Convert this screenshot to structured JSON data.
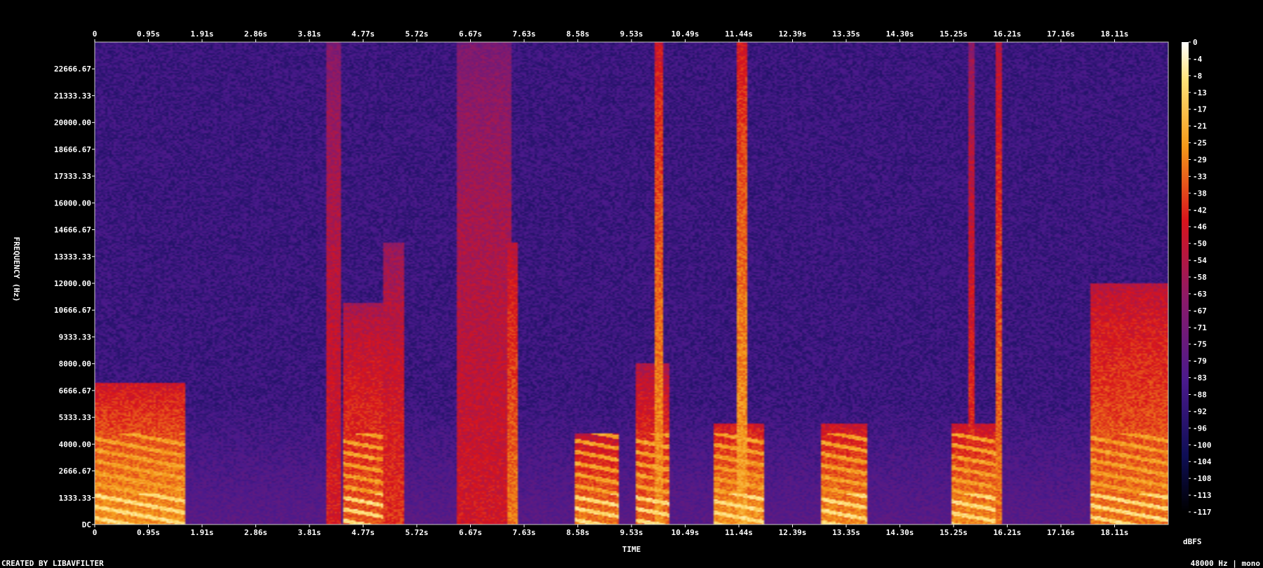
{
  "footer": {
    "left": "CREATED BY LIBAVFILTER",
    "right": "48000 Hz | mono"
  },
  "chart_data": {
    "type": "heatmap",
    "title": "",
    "xlabel": "TIME",
    "ylabel": "FREQUENCY (Hz)",
    "colorbar_label": "dBFS",
    "x_ticks": [
      "0",
      "0.95s",
      "1.91s",
      "2.86s",
      "3.81s",
      "4.77s",
      "5.72s",
      "6.67s",
      "7.63s",
      "8.58s",
      "9.53s",
      "10.49s",
      "11.44s",
      "12.39s",
      "13.35s",
      "14.30s",
      "15.25s",
      "16.21s",
      "17.16s",
      "18.11s"
    ],
    "y_ticks": [
      "DC",
      "1333.33",
      "2666.67",
      "4000.00",
      "5333.33",
      "6666.67",
      "8000.00",
      "9333.33",
      "10666.67",
      "12000.00",
      "13333.33",
      "14666.67",
      "16000.00",
      "17333.33",
      "18666.67",
      "20000.00",
      "21333.33",
      "22666.67"
    ],
    "colorbar_ticks": [
      "0",
      "-4",
      "-8",
      "-13",
      "-17",
      "-21",
      "-25",
      "-29",
      "-33",
      "-38",
      "-42",
      "-46",
      "-50",
      "-54",
      "-58",
      "-63",
      "-67",
      "-71",
      "-75",
      "-79",
      "-83",
      "-88",
      "-92",
      "-96",
      "-100",
      "-104",
      "-108",
      "-113",
      "-117"
    ],
    "xlim": [
      0,
      19.05
    ],
    "ylim": [
      0,
      24000
    ],
    "zlim": [
      -120,
      0
    ],
    "colors": {
      "background": "#000000",
      "noise_floor": "#4a1a8c",
      "mid": "#cc1020",
      "hot": "#ffd040",
      "peak": "#ffffff"
    },
    "bursts": [
      {
        "t0": 0.0,
        "t1": 1.6,
        "fmax": 7000,
        "level": -30
      },
      {
        "t0": 4.1,
        "t1": 4.35,
        "fmax": 24000,
        "level": -50
      },
      {
        "t0": 4.4,
        "t1": 5.1,
        "fmax": 11000,
        "level": -40
      },
      {
        "t0": 5.1,
        "t1": 5.5,
        "fmax": 14000,
        "level": -45
      },
      {
        "t0": 6.4,
        "t1": 7.4,
        "fmax": 24000,
        "level": -52
      },
      {
        "t0": 7.3,
        "t1": 7.5,
        "fmax": 14000,
        "level": -35
      },
      {
        "t0": 8.5,
        "t1": 9.3,
        "fmax": 4500,
        "level": -35
      },
      {
        "t0": 9.6,
        "t1": 10.2,
        "fmax": 8000,
        "level": -38
      },
      {
        "t0": 9.95,
        "t1": 10.1,
        "fmax": 24000,
        "level": -30
      },
      {
        "t0": 11.0,
        "t1": 11.9,
        "fmax": 5000,
        "level": -30
      },
      {
        "t0": 11.4,
        "t1": 11.6,
        "fmax": 24000,
        "level": -28
      },
      {
        "t0": 12.9,
        "t1": 13.7,
        "fmax": 5000,
        "level": -32
      },
      {
        "t0": 15.2,
        "t1": 16.0,
        "fmax": 5000,
        "level": -32
      },
      {
        "t0": 15.5,
        "t1": 15.62,
        "fmax": 24000,
        "level": -45
      },
      {
        "t0": 16.0,
        "t1": 16.12,
        "fmax": 24000,
        "level": -35
      },
      {
        "t0": 17.7,
        "t1": 19.05,
        "fmax": 12000,
        "level": -35
      }
    ]
  }
}
